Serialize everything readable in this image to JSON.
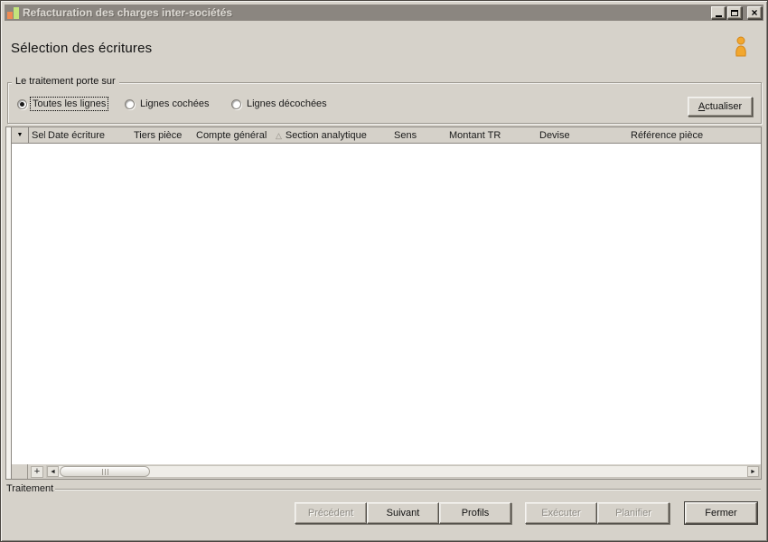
{
  "titlebar": {
    "title": "Refacturation des charges inter-sociétés",
    "app_icon": "bar-chart-icon",
    "close_glyph": "×"
  },
  "header": {
    "page_title": "Sélection des écritures",
    "user_icon": "user-icon"
  },
  "filter_group": {
    "label": "Le traitement porte sur",
    "options": [
      {
        "label": "Toutes les lignes",
        "selected": true
      },
      {
        "label": "Lignes cochées",
        "selected": false
      },
      {
        "label": "Lignes décochées",
        "selected": false
      }
    ],
    "refresh_button_label": "Actualiser"
  },
  "grid": {
    "filter_icon": "▼",
    "sort_icon": "△",
    "sorted_column": "Section analytique",
    "columns": [
      "Sel",
      "Date écriture",
      "Tiers pièce",
      "Compte général",
      "Section analytique",
      "Sens",
      "Montant TR",
      "Devise",
      "Référence pièce"
    ],
    "rows": [],
    "scrollbar": {
      "expand": "+",
      "left_arrow": "◄",
      "right_arrow": "►"
    }
  },
  "status_group": {
    "label": "Traitement"
  },
  "footer": {
    "buttons": [
      {
        "label": "Précédent",
        "enabled": false
      },
      {
        "label": "Suivant",
        "enabled": true
      },
      {
        "label": "Profils",
        "enabled": true
      },
      {
        "label": "Exécuter",
        "enabled": false
      },
      {
        "label": "Planifier",
        "enabled": false
      },
      {
        "label": "Fermer",
        "enabled": true
      }
    ]
  },
  "colors": {
    "window_bg": "#d6d2ca",
    "titlebar_bg": "#8b8680",
    "titlebar_text": "#dcd9d3",
    "grid_header_bg": "#d5d1c9",
    "grid_body_bg": "#ffffff",
    "border_dark": "#8a8680",
    "app_icon_orange": "#ef8b53",
    "app_icon_green": "#c3e47c",
    "user_icon_orange": "#f2a72e",
    "disabled_text": "#8d8a83"
  }
}
